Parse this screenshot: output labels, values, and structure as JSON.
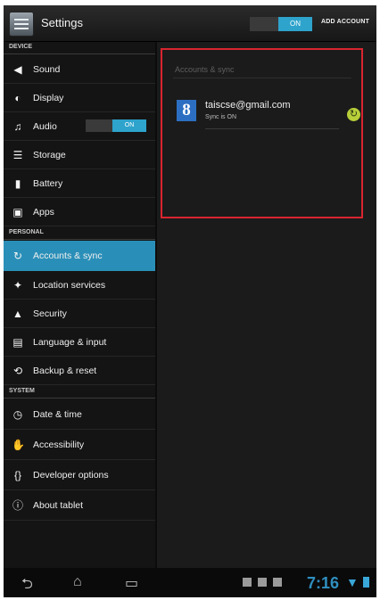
{
  "header": {
    "title": "Settings",
    "master_toggle": "ON",
    "add_account": "ADD ACCOUNT"
  },
  "sidebar": {
    "sections": [
      {
        "title": "DEVICE",
        "items": [
          {
            "label": "Sound",
            "icon": "speaker-icon"
          },
          {
            "label": "Display",
            "icon": "display-icon"
          },
          {
            "label": "Audio",
            "icon": "audio-icon",
            "toggle": "ON"
          },
          {
            "label": "Storage",
            "icon": "storage-icon"
          },
          {
            "label": "Battery",
            "icon": "battery-icon"
          },
          {
            "label": "Apps",
            "icon": "apps-icon"
          }
        ]
      },
      {
        "title": "PERSONAL",
        "items": [
          {
            "label": "Accounts & sync",
            "icon": "sync-icon"
          },
          {
            "label": "Location services",
            "icon": "location-icon"
          },
          {
            "label": "Security",
            "icon": "lock-icon"
          },
          {
            "label": "Language & input",
            "icon": "language-icon"
          },
          {
            "label": "Backup & reset",
            "icon": "backup-icon"
          }
        ]
      },
      {
        "title": "SYSTEM",
        "items": [
          {
            "label": "Date & time",
            "icon": "clock-icon"
          },
          {
            "label": "Accessibility",
            "icon": "accessibility-icon"
          },
          {
            "label": "Developer options",
            "icon": "developer-icon"
          },
          {
            "label": "About tablet",
            "icon": "info-icon"
          }
        ]
      }
    ]
  },
  "main": {
    "header": "Accounts & sync",
    "account": {
      "email": "taiscse@gmail.com",
      "status": "Sync is ON",
      "provider_letter": "8"
    }
  },
  "navbar": {
    "clock": "7:16"
  },
  "colors": {
    "accent": "#2a8fb8",
    "highlight_border": "#d9252f",
    "sync_ok": "#b8cf3a"
  }
}
